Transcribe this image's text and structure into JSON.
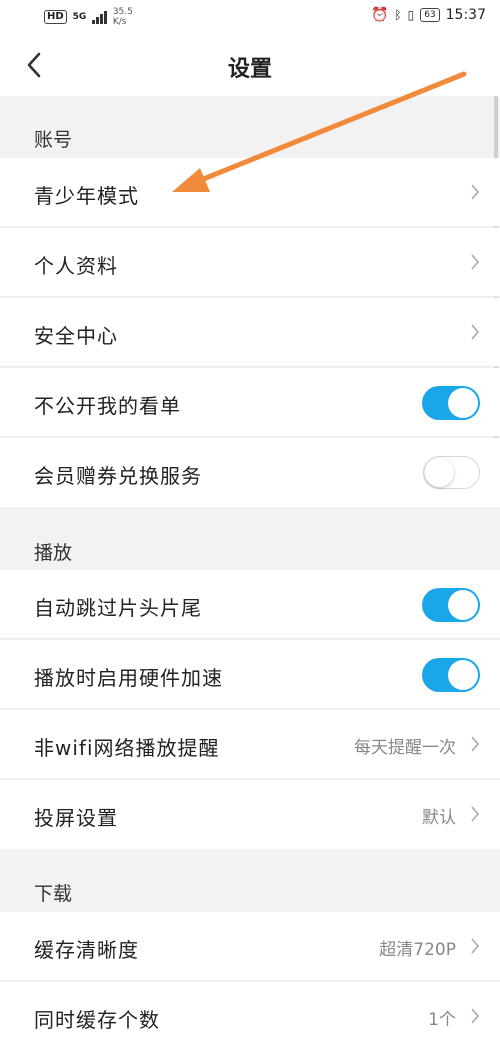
{
  "status": {
    "left_badge": "HD",
    "net_type": "5G",
    "speed_value": "35.5",
    "speed_unit": "K/s",
    "battery": "63",
    "time": "15:37"
  },
  "header": {
    "title": "设置"
  },
  "sections": {
    "account": "账号",
    "play": "播放",
    "download": "下载"
  },
  "rows": {
    "youth_mode": "青少年模式",
    "profile": "个人资料",
    "security": "安全中心",
    "hide_watchlist": "不公开我的看单",
    "coupon": "会员赠券兑换服务",
    "skip_intro": "自动跳过片头片尾",
    "hw_accel": "播放时启用硬件加速",
    "non_wifi": "非wifi网络播放提醒",
    "non_wifi_value": "每天提醒一次",
    "cast": "投屏设置",
    "cast_value": "默认",
    "cache_quality": "缓存清晰度",
    "cache_quality_value": "超清720P",
    "concurrent_cache": "同时缓存个数",
    "concurrent_cache_value": "1个"
  },
  "toggles": {
    "hide_watchlist": true,
    "coupon": false,
    "skip_intro": true,
    "hw_accel": true
  },
  "colors": {
    "accent": "#1aa7ea",
    "annotation_arrow": "#f28a3c"
  }
}
